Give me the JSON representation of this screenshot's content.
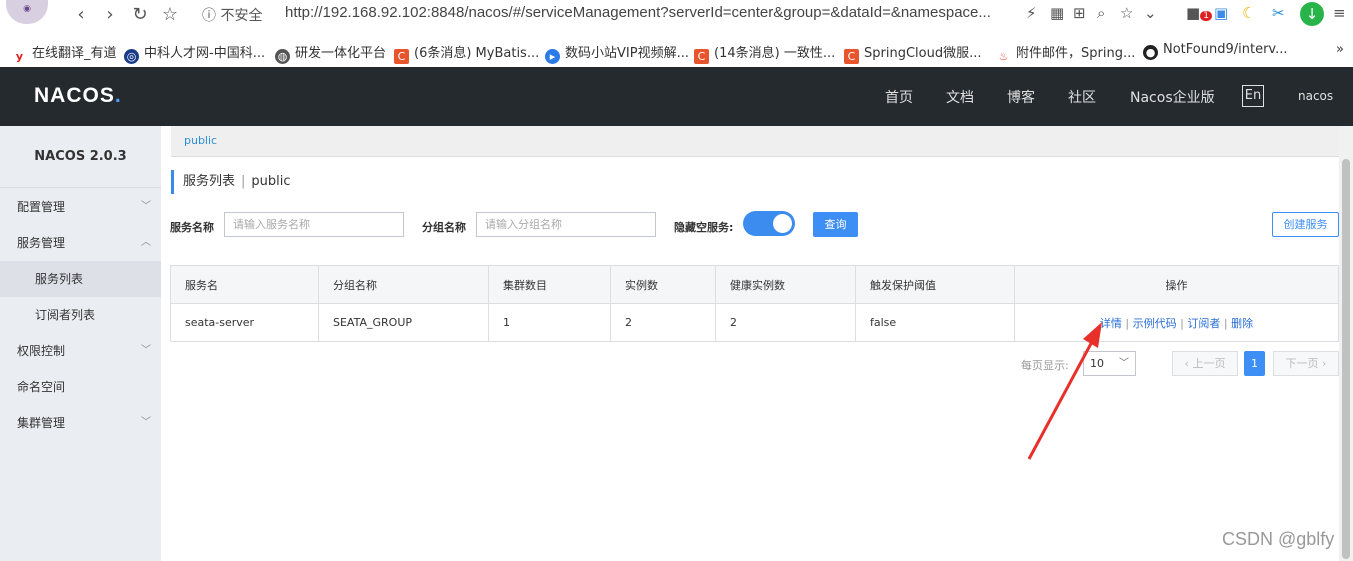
{
  "browser": {
    "security_label": "不安全",
    "url": "http://192.168.92.102:8848/nacos/#/serviceManagement?serverId=center&group=&dataId=&namespace...",
    "bookmarks": [
      {
        "label": "在线翻译_有道",
        "icon": "youdao-icon",
        "color": "#e02020"
      },
      {
        "label": "中科人才网-中国科...",
        "icon": "globe-icon",
        "color": "#1a3a8a"
      },
      {
        "label": "研发一体化平台",
        "icon": "globe-icon",
        "color": "#555555"
      },
      {
        "label": "(6条消息) MyBatis...",
        "icon": "csdn-icon",
        "color": "#e8552c"
      },
      {
        "label": "数码小站VIP视频解...",
        "icon": "video-icon",
        "color": "#2a7ae8"
      },
      {
        "label": "(14条消息) 一致性...",
        "icon": "csdn-icon",
        "color": "#e8552c"
      },
      {
        "label": "SpringCloud微服...",
        "icon": "csdn-icon",
        "color": "#e8552c"
      },
      {
        "label": "附件邮件，Spring...",
        "icon": "flame-icon",
        "color": "#e84c3c"
      },
      {
        "label": "NotFound9/interv...",
        "icon": "github-icon",
        "color": "#222222"
      }
    ],
    "bookmarks_more": "»",
    "badge_count": "1"
  },
  "topnav": {
    "logo_main": "NACOS",
    "logo_dot": ".",
    "links": [
      "首页",
      "文档",
      "博客",
      "社区",
      "Nacos企业版"
    ],
    "lang": "En",
    "user": "nacos"
  },
  "sidebar": {
    "title": "NACOS 2.0.3",
    "items": [
      {
        "label": "配置管理",
        "caret": "﹀"
      },
      {
        "label": "服务管理",
        "caret": "︿"
      },
      {
        "label": "服务列表",
        "caret": ""
      },
      {
        "label": "订阅者列表",
        "caret": ""
      },
      {
        "label": "权限控制",
        "caret": "﹀"
      },
      {
        "label": "命名空间",
        "caret": ""
      },
      {
        "label": "集群管理",
        "caret": "﹀"
      }
    ]
  },
  "main": {
    "crumb": "public",
    "title": "服务列表",
    "title_sep": "|",
    "title_ns": "public",
    "service_name_label": "服务名称",
    "service_name_placeholder": "请输入服务名称",
    "group_name_label": "分组名称",
    "group_name_placeholder": "请输入分组名称",
    "hide_empty_label": "隐藏空服务:",
    "hide_empty_on": true,
    "query_button": "查询",
    "create_button": "创建服务",
    "table": {
      "headers": [
        "服务名",
        "分组名称",
        "集群数目",
        "实例数",
        "健康实例数",
        "触发保护阈值",
        "操作"
      ],
      "rows": [
        {
          "service": "seata-server",
          "group": "SEATA_GROUP",
          "clusters": "1",
          "instances": "2",
          "healthy": "2",
          "threshold": "false"
        }
      ],
      "ops": [
        "详情",
        "示例代码",
        "订阅者",
        "删除"
      ],
      "op_sep": "|"
    },
    "pager": {
      "page_size_label": "每页显示:",
      "page_size": "10",
      "prev": "上一页",
      "next": "下一页",
      "current": "1"
    }
  },
  "watermark": "CSDN @gblfy",
  "colors": {
    "accent": "#3d8ef5",
    "nav_bg": "#252a2f",
    "sidebar_bg": "#eaedf1",
    "annotation_arrow": "#e8302a"
  }
}
